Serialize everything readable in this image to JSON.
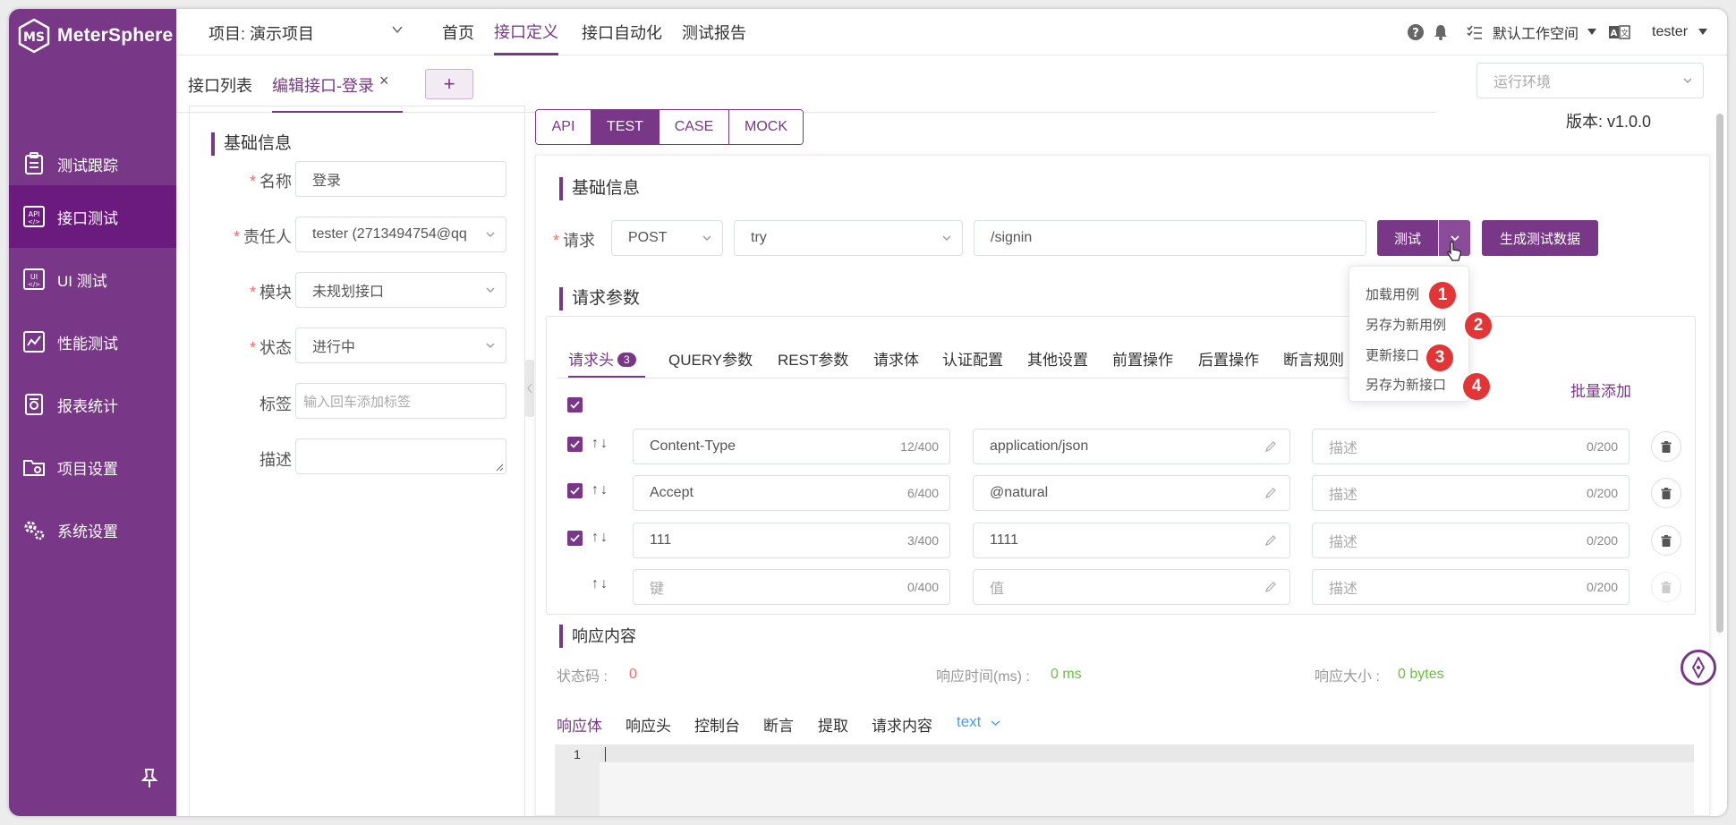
{
  "app": {
    "name": "MeterSphere"
  },
  "sidebar": {
    "items": [
      {
        "label": "测试跟踪",
        "icon": "clipboard-icon"
      },
      {
        "label": "接口测试",
        "icon": "api-icon",
        "active": true
      },
      {
        "label": "UI 测试",
        "icon": "ui-test-icon"
      },
      {
        "label": "性能测试",
        "icon": "performance-chart-icon"
      },
      {
        "label": "报表统计",
        "icon": "report-icon"
      },
      {
        "label": "项目设置",
        "icon": "folder-settings-icon"
      },
      {
        "label": "系统设置",
        "icon": "gears-icon"
      }
    ]
  },
  "header": {
    "project": "项目: 演示项目",
    "nav": [
      "首页",
      "接口定义",
      "接口自动化",
      "测试报告"
    ],
    "active_nav": "接口定义",
    "workspace": "默认工作空间",
    "user": "tester"
  },
  "page_tabs": {
    "items": [
      "接口列表",
      "编辑接口-登录"
    ],
    "add": "+"
  },
  "env_select": {
    "placeholder": "运行环境"
  },
  "basic_info": {
    "title": "基础信息",
    "fields": {
      "name_label": "名称",
      "name_value": "登录",
      "owner_label": "责任人",
      "owner_value": "tester (2713494754@qq",
      "module_label": "模块",
      "module_value": "未规划接口",
      "status_label": "状态",
      "status_value": "进行中",
      "tags_label": "标签",
      "tags_placeholder": "输入回车添加标签",
      "desc_label": "描述"
    }
  },
  "mode_tabs": [
    "API",
    "TEST",
    "CASE",
    "MOCK"
  ],
  "active_mode": "TEST",
  "version": "版本: v1.0.0",
  "request": {
    "section_title": "基础信息",
    "label": "请求",
    "method": "POST",
    "env": "try",
    "path": "/signin",
    "test_button": "测试",
    "generate_button": "生成测试数据"
  },
  "test_dropdown": {
    "items": [
      "加载用例",
      "另存为新用例",
      "更新接口",
      "另存为新接口"
    ],
    "badges": [
      "1",
      "2",
      "3",
      "4"
    ]
  },
  "params": {
    "title": "请求参数",
    "tabs": [
      "请求头",
      "QUERY参数",
      "REST参数",
      "请求体",
      "认证配置",
      "其他设置",
      "前置操作",
      "后置操作",
      "断言规则"
    ],
    "header_count": "3",
    "bulk_add": "批量添加",
    "rows": [
      {
        "key": "Content-Type",
        "key_count": "12/400",
        "value": "application/json",
        "desc": "描述",
        "desc_count": "0/200",
        "checked": true
      },
      {
        "key": "Accept",
        "key_count": "6/400",
        "value": "@natural",
        "desc": "描述",
        "desc_count": "0/200",
        "checked": true
      },
      {
        "key": "111",
        "key_count": "3/400",
        "value": "1111",
        "desc": "描述",
        "desc_count": "0/200",
        "checked": true
      },
      {
        "key": "键",
        "key_count": "0/400",
        "value": "值",
        "desc": "描述",
        "desc_count": "0/200",
        "checked": false
      }
    ]
  },
  "response": {
    "title": "响应内容",
    "status_label": "状态码 :",
    "status_value": "0",
    "time_label": "响应时间(ms) :",
    "time_value": "0 ms",
    "size_label": "响应大小 :",
    "size_value": "0 bytes",
    "tabs": [
      "响应体",
      "响应头",
      "控制台",
      "断言",
      "提取",
      "请求内容"
    ],
    "format": "text",
    "line_number": "1"
  },
  "colors": {
    "primary": "#783887",
    "danger": "#f56c6c",
    "success": "#67c23a",
    "badge": "#e33535"
  }
}
